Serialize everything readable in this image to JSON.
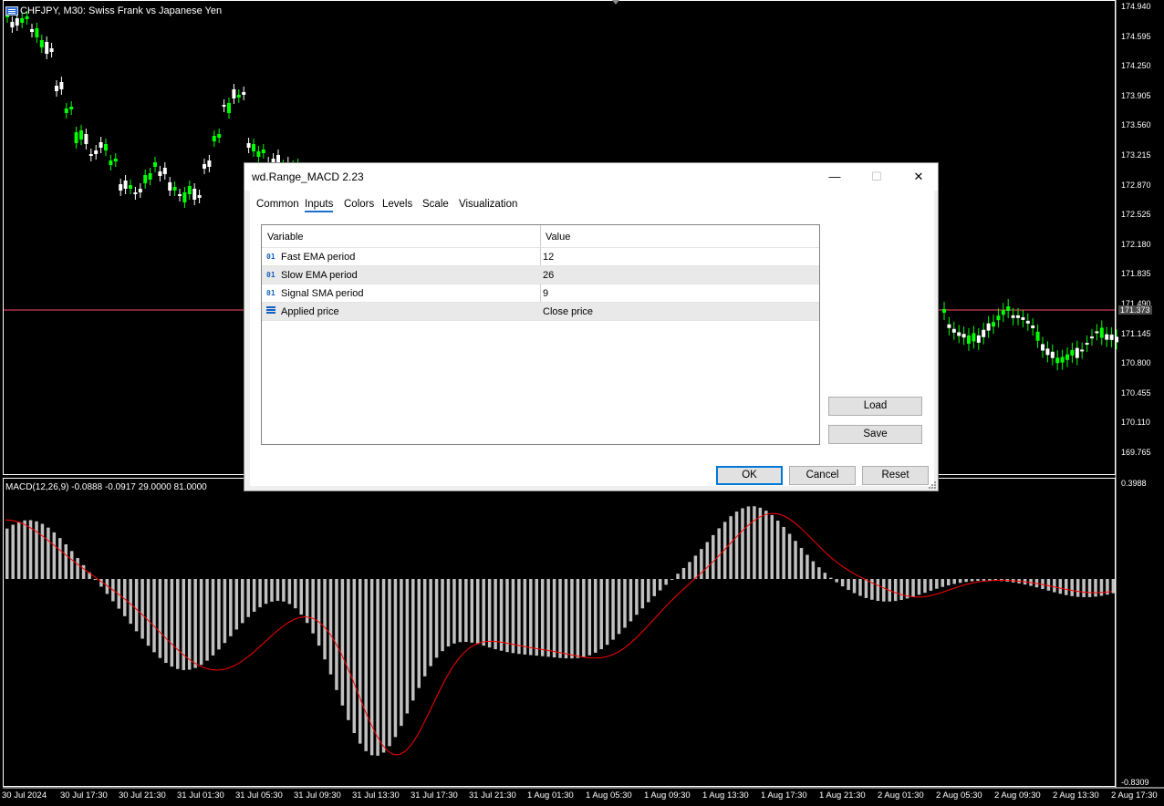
{
  "chart": {
    "symbol_title": "CHFJPY, M30:  Swiss Frank vs Japanese Yen",
    "macd_title": "MACD(12,26,9) -0.0888 -0.0917 29.0000 81.0000",
    "price_labels": [
      "174.940",
      "174.595",
      "174.250",
      "173.905",
      "173.560",
      "173.215",
      "172.870",
      "172.525",
      "172.180",
      "171.835",
      "171.490",
      "171.145",
      "170.800",
      "170.455",
      "170.110",
      "169.765"
    ],
    "current_price": "171.373",
    "macd_max_label": "0.3988",
    "macd_min_label": "-0.8309",
    "time_labels": [
      "30 Jul 2024",
      "30 Jul 17:30",
      "30 Jul 21:30",
      "31 Jul 01:30",
      "31 Jul 05:30",
      "31 Jul 09:30",
      "31 Jul 13:30",
      "31 Jul 17:30",
      "31 Jul 21:30",
      "1 Aug 01:30",
      "1 Aug 05:30",
      "1 Aug 09:30",
      "1 Aug 13:30",
      "1 Aug 17:30",
      "1 Aug 21:30",
      "2 Aug 01:30",
      "2 Aug 05:30",
      "2 Aug 09:30",
      "2 Aug 13:30",
      "2 Aug 17:30"
    ],
    "colors": {
      "bull": "#00ff00",
      "bear": "#ffffff",
      "histogram": "#c0c0c0",
      "signal": "#ff0000",
      "price_line": "#ff4d6a"
    }
  },
  "dialog": {
    "title": "wd.Range_MACD 2.23",
    "controls": {
      "minimize": "—",
      "maximize": "☐",
      "close": "✕"
    },
    "tabs": [
      "Common",
      "Inputs",
      "Colors",
      "Levels",
      "Scale",
      "Visualization"
    ],
    "active_tab": "Inputs",
    "table": {
      "headers": [
        "Variable",
        "Value"
      ],
      "rows": [
        {
          "icon": "int-icon",
          "type_tag": "01",
          "variable": "Fast EMA period",
          "value": "12"
        },
        {
          "icon": "int-icon",
          "type_tag": "01",
          "variable": "Slow EMA period",
          "value": "26"
        },
        {
          "icon": "int-icon",
          "type_tag": "01",
          "variable": "Signal SMA period",
          "value": "9"
        },
        {
          "icon": "list-icon",
          "type_tag": "",
          "variable": "Applied price",
          "value": "Close price"
        }
      ]
    },
    "side_buttons": {
      "load": "Load",
      "save": "Save"
    },
    "buttons": {
      "ok": "OK",
      "cancel": "Cancel",
      "reset": "Reset"
    }
  }
}
